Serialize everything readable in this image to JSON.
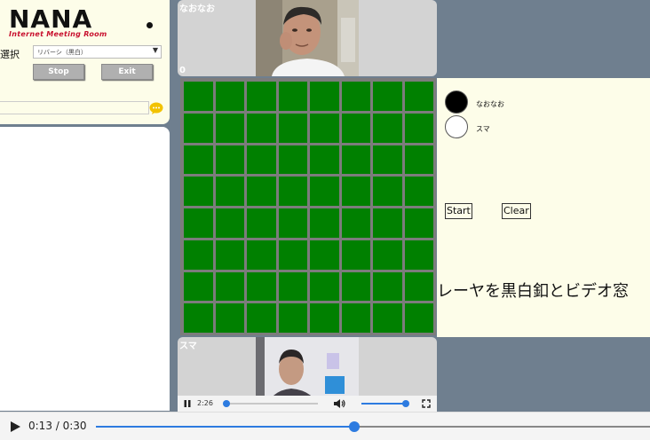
{
  "app": {
    "logo_main": "NANA",
    "logo_sub": "Internet Meeting Room"
  },
  "controls": {
    "select_label": "選択",
    "game_select_value": "リバーシ（黒白）",
    "stop_label": "Stop",
    "exit_label": "Exit"
  },
  "video_top": {
    "name": "なおなお",
    "score": "0"
  },
  "video_bottom": {
    "name": "スマ"
  },
  "players": [
    {
      "name": "なおなお",
      "color": "#000000"
    },
    {
      "name": "スマ",
      "color": "#ffffff"
    }
  ],
  "buttons": {
    "start_label": "Start",
    "clear_label": "Clear"
  },
  "marquee": "レーヤを黒白釦とビデオ窓",
  "inner_player": {
    "time": "2:26",
    "progress": 0.02,
    "volume": 1.0
  },
  "player": {
    "time": "0:13 / 0:30",
    "progress": 0.467
  },
  "colors": {
    "board_green": "#008000",
    "accent_blue": "#2d7be0",
    "logo_red": "#c8102e"
  }
}
